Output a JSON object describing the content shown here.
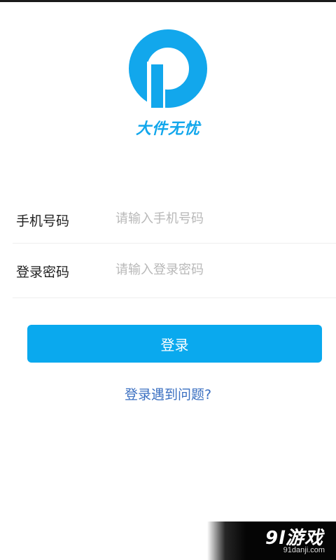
{
  "brand": {
    "name": "大件无忧",
    "logo_icon": "brand-logo-icon",
    "color": "#12a7ec"
  },
  "form": {
    "phone": {
      "label": "手机号码",
      "placeholder": "请输入手机号码",
      "value": ""
    },
    "password": {
      "label": "登录密码",
      "placeholder": "请输入登录密码",
      "value": ""
    }
  },
  "actions": {
    "login_label": "登录",
    "login_color": "#0aa9ee",
    "help_label": "登录遇到问题?",
    "help_color": "#3a6fc1"
  },
  "watermark": {
    "main": "9l游戏",
    "sub": "91danji.com"
  }
}
